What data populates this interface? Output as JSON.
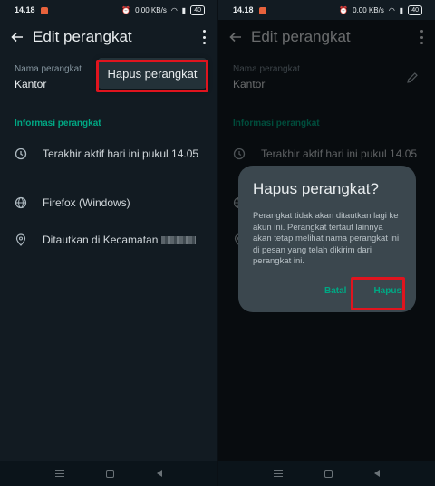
{
  "statusbar": {
    "time": "14.18",
    "network": "0.00 KB/s",
    "battery": "40"
  },
  "appbar": {
    "title": "Edit perangkat"
  },
  "device": {
    "name_label": "Nama perangkat",
    "name_value": "Kantor"
  },
  "popup_menu": {
    "item": "Hapus perangkat"
  },
  "section": {
    "header": "Informasi perangkat"
  },
  "info": {
    "last_active": "Terakhir aktif hari ini pukul 14.05",
    "browser": "Firefox (Windows)",
    "location": "Ditautkan di Kecamatan"
  },
  "dialog": {
    "title": "Hapus perangkat?",
    "message": "Perangkat tidak akan ditautkan lagi ke akun ini. Perangkat tertaut lainnya akan tetap melihat nama perangkat ini di pesan yang telah dikirim dari perangkat ini.",
    "cancel": "Batal",
    "confirm": "Hapus"
  },
  "colors": {
    "accent": "#00a884",
    "highlight": "#e0141e",
    "background": "#121b22",
    "dialog": "#3b474e"
  },
  "icons": [
    "back-arrow-icon",
    "more-vert-icon",
    "pencil-icon",
    "clock-icon",
    "globe-icon",
    "location-pin-icon",
    "recent-apps-icon",
    "home-icon",
    "nav-back-icon"
  ]
}
